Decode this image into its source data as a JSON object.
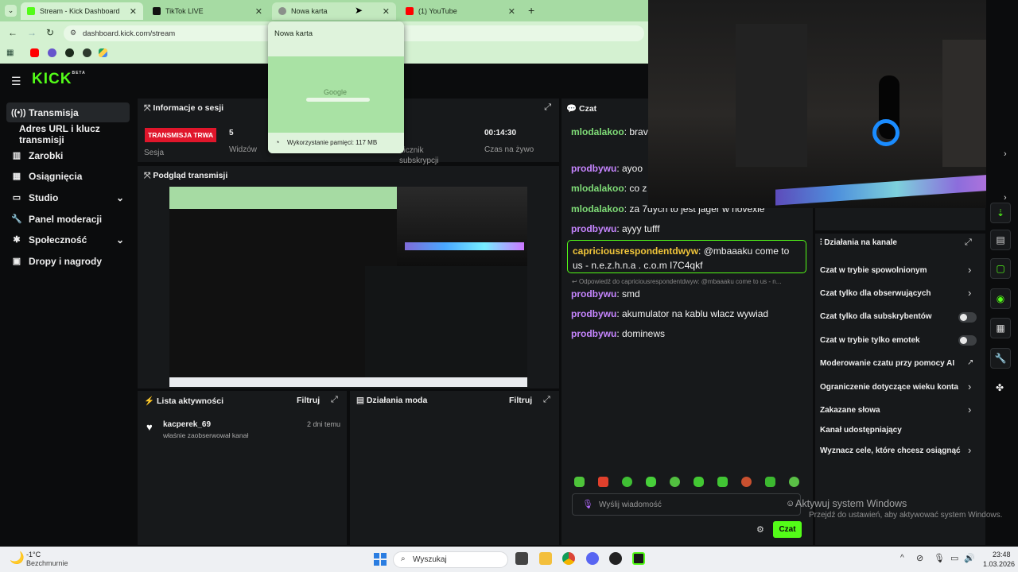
{
  "browser": {
    "tabs": [
      {
        "label": "Stream - Kick Dashboard",
        "color": "#53fc18"
      },
      {
        "label": "TikTok LIVE",
        "color": "#111111"
      },
      {
        "label": "Nowa karta",
        "color": "#8a8f8a"
      },
      {
        "label": "(1) YouTube",
        "color": "#ff0000"
      }
    ],
    "url": "dashboard.kick.com/stream",
    "hover_card": {
      "title": "Nowa karta",
      "google_word": "Google",
      "memory": "Wykorzystanie pamięci: 117 MB"
    }
  },
  "kick": {
    "logo": "KICK",
    "beta": "BETA",
    "nav": [
      {
        "label": "Transmisja",
        "icon": "broadcast-icon"
      },
      {
        "label": "Adres URL i klucz transmisji",
        "icon": ""
      },
      {
        "label": "Zarobki",
        "icon": "earnings-icon"
      },
      {
        "label": "Osiągnięcia",
        "icon": "achievements-icon"
      },
      {
        "label": "Studio",
        "icon": "studio-icon"
      },
      {
        "label": "Panel moderacji",
        "icon": "wrench-icon"
      },
      {
        "label": "Społeczność",
        "icon": "community-icon"
      },
      {
        "label": "Dropy i nagrody",
        "icon": "gift-icon"
      }
    ],
    "session": {
      "title": "Informacje o sesji",
      "live_badge": "TRANSMISJA TRWA",
      "session_label": "Sesja",
      "viewers_value": "5",
      "viewers_label": "Widzów",
      "subs_label": "Licznik subskrypcji",
      "live_time_value": "00:14:30",
      "live_time_label": "Czas na żywo"
    },
    "preview_title": "Podgląd transmisji",
    "activity": {
      "title": "Lista aktywności",
      "filter": "Filtruj",
      "user": "kacperek_69",
      "time": "2 dni temu",
      "action": "właśnie zaobserwował kanał"
    },
    "mod_actions": {
      "title": "Działania moda",
      "filter": "Filtruj"
    },
    "chat": {
      "title": "Czat",
      "messages": [
        {
          "user": "mlodalakoo",
          "text": "brav",
          "color": "green"
        },
        {
          "user": "prodbywu",
          "text": "ayoo",
          "color": "pink"
        },
        {
          "user": "mlodalakoo",
          "text": "co z",
          "color": "green"
        },
        {
          "user": "mlodalakoo",
          "text": "za 7dych to jest jager w novexie",
          "color": "green"
        },
        {
          "user": "prodbywu",
          "text": "ayyy tufff",
          "color": "pink"
        }
      ],
      "highlight": {
        "user": "capriciousrespondentdwyw",
        "text_line1": "@mbaaaku come to",
        "text_line2": "us - n.e.z.h.n.a . c.o.m I7C4qkf"
      },
      "reply_ref": "Odpowiedź do capriciousrespondentdwyw: @mbaaaku come to us - n...",
      "after": [
        {
          "user": "prodbywu",
          "text": "smd"
        },
        {
          "user": "prodbywu",
          "text": "akumulator na kablu wlacz wywiad"
        },
        {
          "user": "prodbywu",
          "text": "dominews"
        }
      ],
      "input_placeholder": "Wyślij wiadomość",
      "send_label": "Czat"
    },
    "channel_actions": {
      "title": "Działania na kanale",
      "items": [
        {
          "label": "Czat w trybie spowolnionym",
          "control": "chevron"
        },
        {
          "label": "Czat tylko dla obserwujących",
          "control": "chevron"
        },
        {
          "label": "Czat tylko dla subskrybentów",
          "control": "toggle"
        },
        {
          "label": "Czat w trybie tylko emotek",
          "control": "toggle"
        },
        {
          "label": "Moderowanie czatu przy pomocy AI",
          "control": "external"
        },
        {
          "label": "Ograniczenie dotyczące wieku konta",
          "control": "chevron"
        },
        {
          "label": "Zakazane słowa",
          "control": "chevron"
        },
        {
          "label": "Kanał udostępniający",
          "control": "none"
        },
        {
          "label": "Wyznacz cele, które chcesz osiągnąć",
          "control": "chevron"
        }
      ]
    }
  },
  "watermark": {
    "line1": "Aktywuj system Windows",
    "line2": "Przejdź do ustawień, aby aktywować system Windows."
  },
  "taskbar": {
    "weather_temp": "-1°C",
    "weather_desc": "Bezchmurnie",
    "search": "Wyszukaj",
    "time": "23:48",
    "date": "1.03.2026"
  },
  "colors": {
    "accent": "#53fc18",
    "live_red": "#e0162b",
    "panel": "#17191b"
  }
}
